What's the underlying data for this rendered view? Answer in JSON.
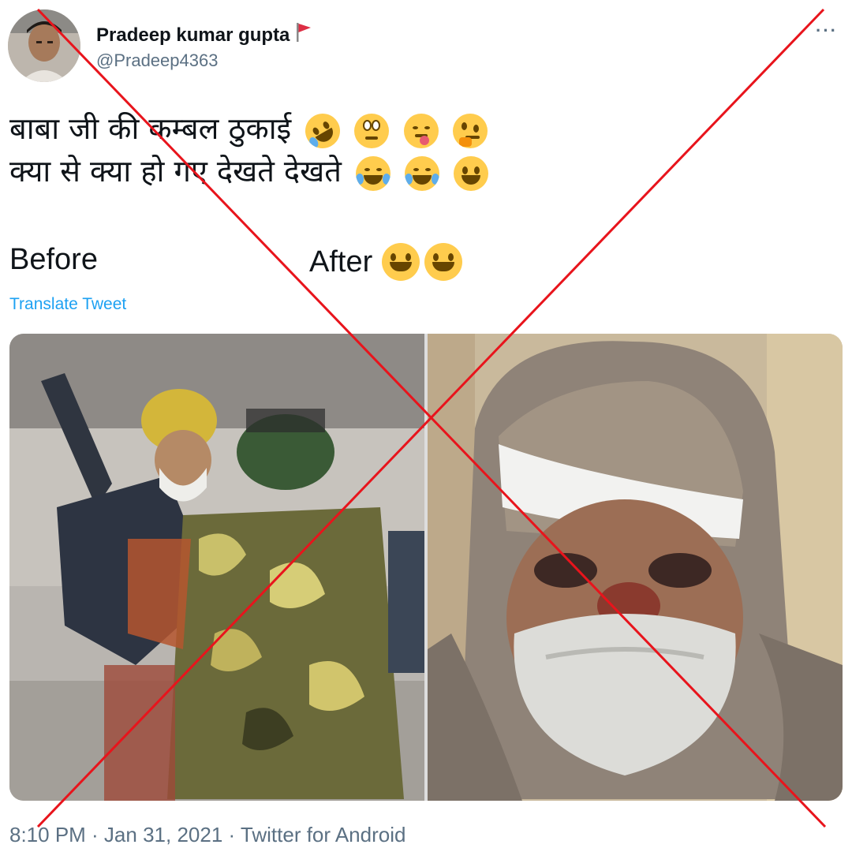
{
  "user": {
    "display_name": "Pradeep kumar gupta",
    "handle": "@Pradeep4363",
    "avatar_icon": "user-avatar",
    "flag_icon": "red-flag-icon"
  },
  "tweet": {
    "line1": "बाबा जी की कम्बल ठुकाई",
    "line2": "क्या से क्या हो गए देखते देखते",
    "before_label": "Before",
    "after_label": "After",
    "translate_label": "Translate Tweet",
    "line1_emojis": [
      "rolling-on-floor-laughing",
      "face-with-rolling-eyes",
      "face-savoring-food",
      "thinking-face"
    ],
    "line2_emojis": [
      "face-with-tears-of-joy",
      "face-with-tears-of-joy",
      "grinning-face"
    ],
    "after_emojis": [
      "grinning-face",
      "grinning-face"
    ]
  },
  "media": {
    "left_image": "photo-before",
    "right_image": "photo-after"
  },
  "meta": {
    "timestamp": "8:10 PM · Jan 31, 2021 · Twitter for Android"
  },
  "colors": {
    "link": "#1da1f2",
    "secondary_text": "#5b7083",
    "cross_overlay": "#e8141c",
    "emoji_yellow": "#ffcc4d"
  }
}
